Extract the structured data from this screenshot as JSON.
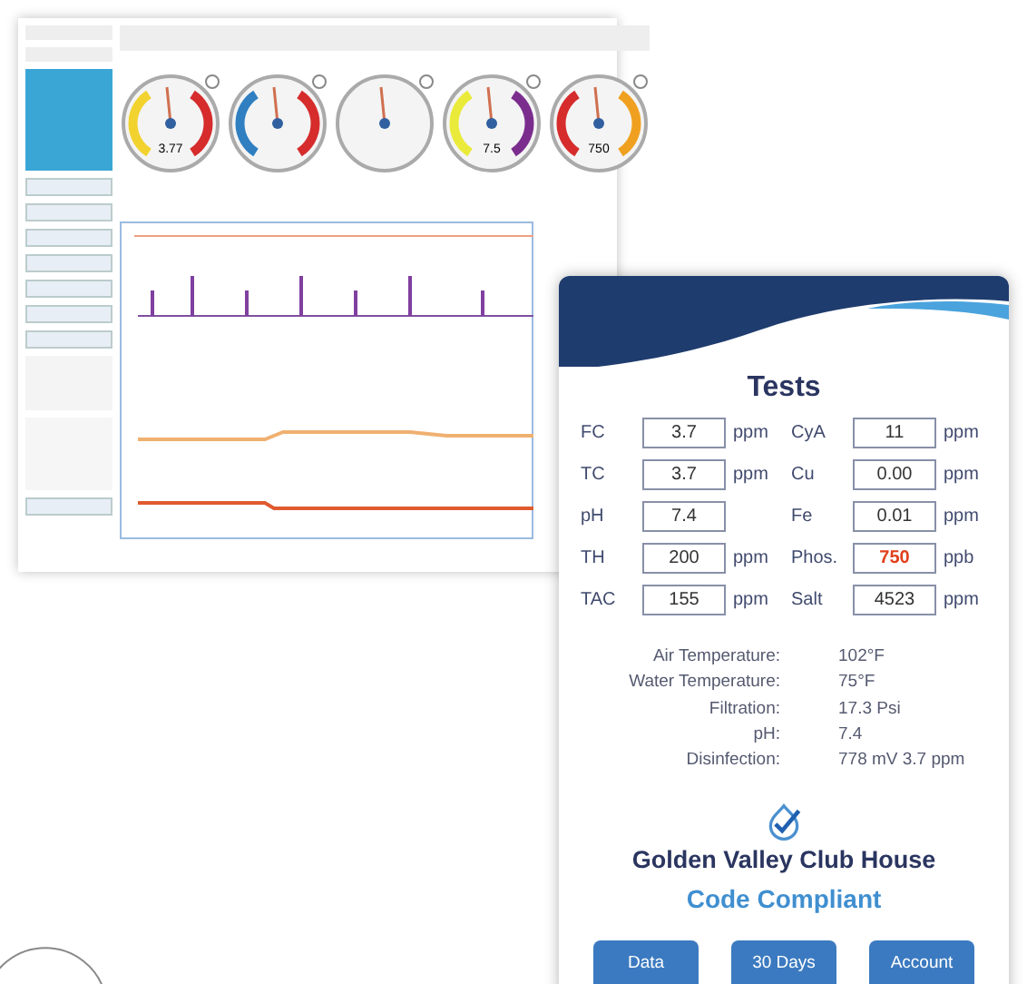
{
  "gauges": [
    {
      "kind": "banded",
      "reading": "3.77",
      "arcs": [
        {
          "color": "#f2d22e"
        },
        {
          "color": "#d62c2c"
        }
      ]
    },
    {
      "kind": "banded",
      "arcs": [
        {
          "color": "#2f7fc1"
        },
        {
          "color": "#d62c2c"
        }
      ]
    },
    {
      "kind": "plain"
    },
    {
      "kind": "banded",
      "reading": "7.5",
      "arcs": [
        {
          "color": "#eaea3a"
        },
        {
          "color": "#7b2d8e"
        }
      ]
    },
    {
      "kind": "banded",
      "reading": "750",
      "arcs": [
        {
          "color": "#d62c2c"
        },
        {
          "color": "#f0a020"
        }
      ]
    }
  ],
  "card": {
    "title": "Tests",
    "tests": [
      {
        "label": "FC",
        "value": "3.7",
        "unit": "ppm",
        "alert": false
      },
      {
        "label": "CyA",
        "value": "11",
        "unit": "ppm",
        "alert": false
      },
      {
        "label": "TC",
        "value": "3.7",
        "unit": "ppm",
        "alert": false
      },
      {
        "label": "Cu",
        "value": "0.00",
        "unit": "ppm",
        "alert": false
      },
      {
        "label": "pH",
        "value": "7.4",
        "alert": false
      },
      {
        "label": "Fe",
        "value": "0.01",
        "unit": "ppm",
        "alert": false
      },
      {
        "label": "TH",
        "value": "200",
        "unit": "ppm",
        "alert": false
      },
      {
        "label": "Phos.",
        "value": "750",
        "unit": "ppb",
        "alert": true
      },
      {
        "label": "TAC",
        "value": "155",
        "unit": "ppm",
        "alert": false
      },
      {
        "label": "Salt",
        "value": "4523",
        "unit": "ppm",
        "alert": false
      }
    ],
    "readings": [
      {
        "label": "Air Temperature:",
        "value": "102°F"
      },
      {
        "label": "Water Temperature:",
        "value": "75°F"
      },
      {
        "label": "Filtration:",
        "value": "17.3 Psi"
      },
      {
        "label": "pH:",
        "value": "7.4"
      },
      {
        "label": "Disinfection:",
        "value": "778 mV 3.7 ppm"
      }
    ],
    "site": "Golden Valley Club House",
    "status": "Code Compliant",
    "buttons": [
      "Data",
      "30 Days",
      "Account"
    ]
  }
}
